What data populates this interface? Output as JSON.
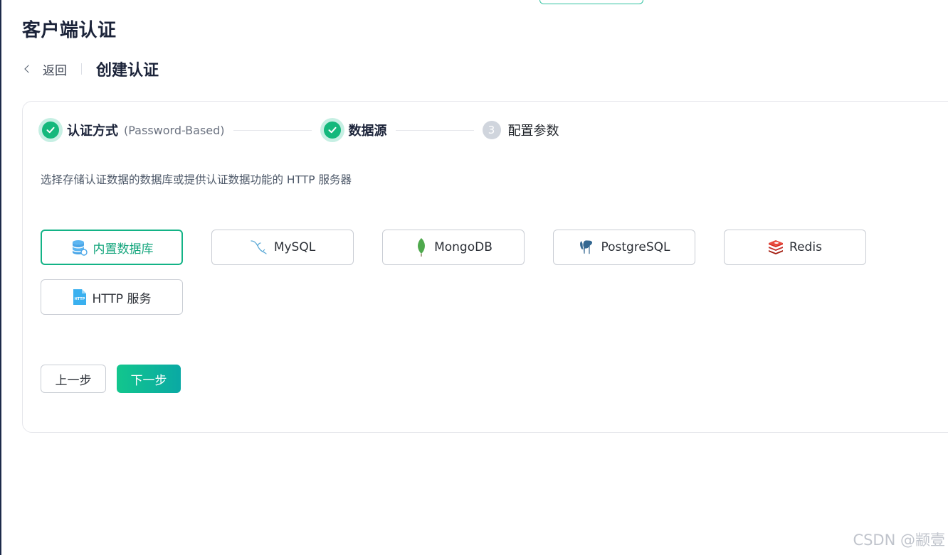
{
  "header": {
    "title": "客户端认证"
  },
  "breadcrumb": {
    "back_label": "返回",
    "current": "创建认证"
  },
  "steps": [
    {
      "label": "认证方式",
      "sub": "(Password-Based)",
      "status": "done"
    },
    {
      "label": "数据源",
      "status": "done"
    },
    {
      "number": "3",
      "label": "配置参数",
      "status": "pending"
    }
  ],
  "description": "选择存储认证数据的数据库或提供认证数据功能的 HTTP 服务器",
  "options": [
    {
      "label": "内置数据库",
      "icon": "database-icon",
      "selected": true
    },
    {
      "label": "MySQL",
      "icon": "mysql-dolphin-icon"
    },
    {
      "label": "MongoDB",
      "icon": "mongodb-leaf-icon"
    },
    {
      "label": "PostgreSQL",
      "icon": "postgresql-elephant-icon"
    },
    {
      "label": "Redis",
      "icon": "redis-icon"
    },
    {
      "label": "HTTP 服务",
      "icon": "http-file-icon"
    }
  ],
  "buttons": {
    "prev": "上一步",
    "next": "下一步"
  },
  "watermark": "CSDN @颛壹",
  "colors": {
    "accent": "#13b386",
    "check": "#14b87c",
    "title": "#1b2339"
  }
}
